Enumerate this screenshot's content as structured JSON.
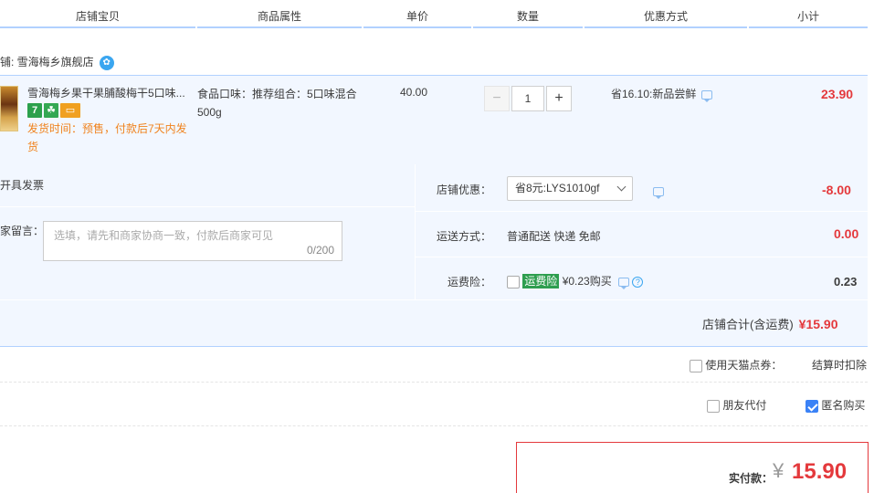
{
  "header": {
    "columns": [
      "店铺宝贝",
      "商品属性",
      "单价",
      "数量",
      "优惠方式",
      "小计"
    ]
  },
  "shop": {
    "label": "铺: 雪海梅乡旗舰店"
  },
  "item": {
    "title": "雪海梅乡果干果脯酸梅干5口味...",
    "badge_7": "7",
    "ship_note": "发货时间：预售，付款后7天内发货",
    "attributes": "食品口味：推荐组合：5口味混合500g",
    "unit_price": "40.00",
    "quantity": "1",
    "minus": "−",
    "plus": "+",
    "promo": "省16.10:新品尝鲜",
    "subtotal": "23.90"
  },
  "order": {
    "invoice_label": "开具发票",
    "message_label": "家留言：",
    "message_placeholder": "选填，请先和商家协商一致，付款后商家可见",
    "message_count": "0/200",
    "shop_discount_label": "店铺优惠：",
    "shop_discount_value": "省8元:LYS1010gf",
    "shop_discount_amount": "-8.00",
    "shipping_label": "运送方式：",
    "shipping_value": "普通配送 快递 免邮",
    "shipping_amount": "0.00",
    "insurance_label": "运费险：",
    "insurance_tag": "运费险",
    "insurance_text": "¥0.23购买",
    "insurance_amount": "0.23",
    "shop_total_label": "店铺合计(含运费)",
    "shop_total_amount": "¥15.90"
  },
  "options": {
    "coupon_label": "使用天猫点券：",
    "coupon_note": "结算时扣除",
    "friend_pay_label": "朋友代付",
    "anonymous_label": "匿名购买",
    "anonymous_checked": true,
    "friend_pay_checked": false
  },
  "pay": {
    "label": "实付款：",
    "currency": "¥",
    "amount": "15.90"
  }
}
